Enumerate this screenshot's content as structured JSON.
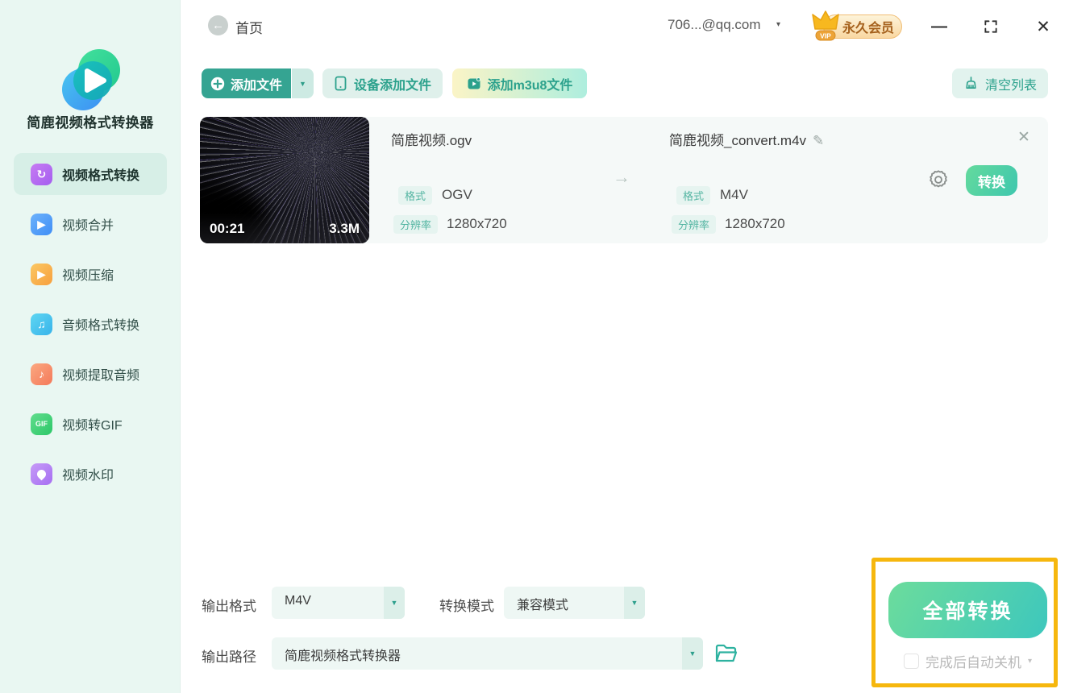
{
  "app_title": "简鹿视频格式转换器",
  "titlebar": {
    "home_label": "首页",
    "account": "706...@qq.com",
    "vip_label": "永久会员",
    "vip_small": "VIP"
  },
  "sidebar": {
    "items": [
      {
        "label": "视频格式转换",
        "icon": "video-convert-icon",
        "glyph": "↻",
        "active": true
      },
      {
        "label": "视频合并",
        "icon": "video-merge-icon",
        "glyph": "▶",
        "active": false
      },
      {
        "label": "视频压缩",
        "icon": "video-compress-icon",
        "glyph": "▶",
        "active": false
      },
      {
        "label": "音频格式转换",
        "icon": "audio-convert-icon",
        "glyph": "♫",
        "active": false
      },
      {
        "label": "视频提取音频",
        "icon": "audio-extract-icon",
        "glyph": "♪",
        "active": false
      },
      {
        "label": "视频转GIF",
        "icon": "gif-icon",
        "glyph": "GIF",
        "active": false
      },
      {
        "label": "视频水印",
        "icon": "watermark-icon",
        "glyph": "",
        "active": false
      }
    ]
  },
  "toolbar": {
    "add_file": "添加文件",
    "device_add": "设备添加文件",
    "add_m3u8": "添加m3u8文件",
    "clear_list": "清空列表"
  },
  "file_row": {
    "duration": "00:21",
    "size": "3.3M",
    "source": {
      "name": "简鹿视频.ogv",
      "format_label": "格式",
      "format": "OGV",
      "resolution_label": "分辨率",
      "resolution": "1280x720"
    },
    "target": {
      "name": "简鹿视频_convert.m4v",
      "format_label": "格式",
      "format": "M4V",
      "resolution_label": "分辨率",
      "resolution": "1280x720"
    },
    "convert_button": "转换"
  },
  "footer": {
    "output_format_label": "输出格式",
    "output_format_value": "M4V",
    "convert_mode_label": "转换模式",
    "convert_mode_value": "兼容模式",
    "output_path_label": "输出路径",
    "output_path_value": "简鹿视频格式转换器",
    "convert_all_label": "全部转换",
    "shutdown_label": "完成后自动关机"
  },
  "glyphs": {
    "back": "←",
    "caret_down": "▼",
    "small_caret": "▾",
    "minimize": "—",
    "close": "✕",
    "arrow_right": "→",
    "edit": "✎"
  },
  "colors": {
    "accent_teal": "#35a492",
    "sidebar_bg": "#e9f7f2",
    "active_item_bg": "#d7efe7",
    "row_bg": "#f5f9f8",
    "badge_text": "#54b5a2",
    "convert_gradient": [
      "#64da9d",
      "#3ec7ae"
    ],
    "convert_all_gradient": [
      "#6cdc9c",
      "#3dc7bd"
    ],
    "highlight_orange": "#f6b70e",
    "vip_text": "#a5611d"
  }
}
